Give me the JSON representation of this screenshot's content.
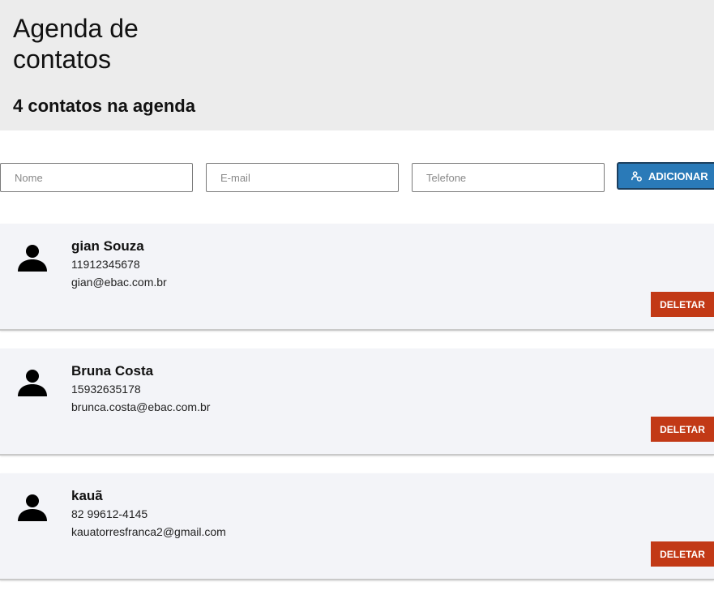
{
  "header": {
    "title": "Agenda de contatos",
    "count_text": "4 contatos na agenda"
  },
  "form": {
    "name_placeholder": "Nome",
    "email_placeholder": "E-mail",
    "phone_placeholder": "Telefone",
    "add_label": "ADICIONAR",
    "add_icon": "user-plus-icon",
    "add_color": "#2a7ab8"
  },
  "contacts": [
    {
      "name": "gian Souza",
      "phone": "11912345678",
      "email": "gian@ebac.com.br",
      "delete_label": "DELETAR"
    },
    {
      "name": "Bruna Costa",
      "phone": "15932635178",
      "email": "brunca.costa@ebac.com.br",
      "delete_label": "DELETAR"
    },
    {
      "name": "kauã",
      "phone": "82 99612-4145",
      "email": "kauatorresfranca2@gmail.com",
      "delete_label": "DELETAR"
    }
  ],
  "colors": {
    "header_bg": "#ececec",
    "card_bg": "#f3f4f8",
    "delete_color": "#c23916"
  },
  "avatar_icon": "user-icon"
}
